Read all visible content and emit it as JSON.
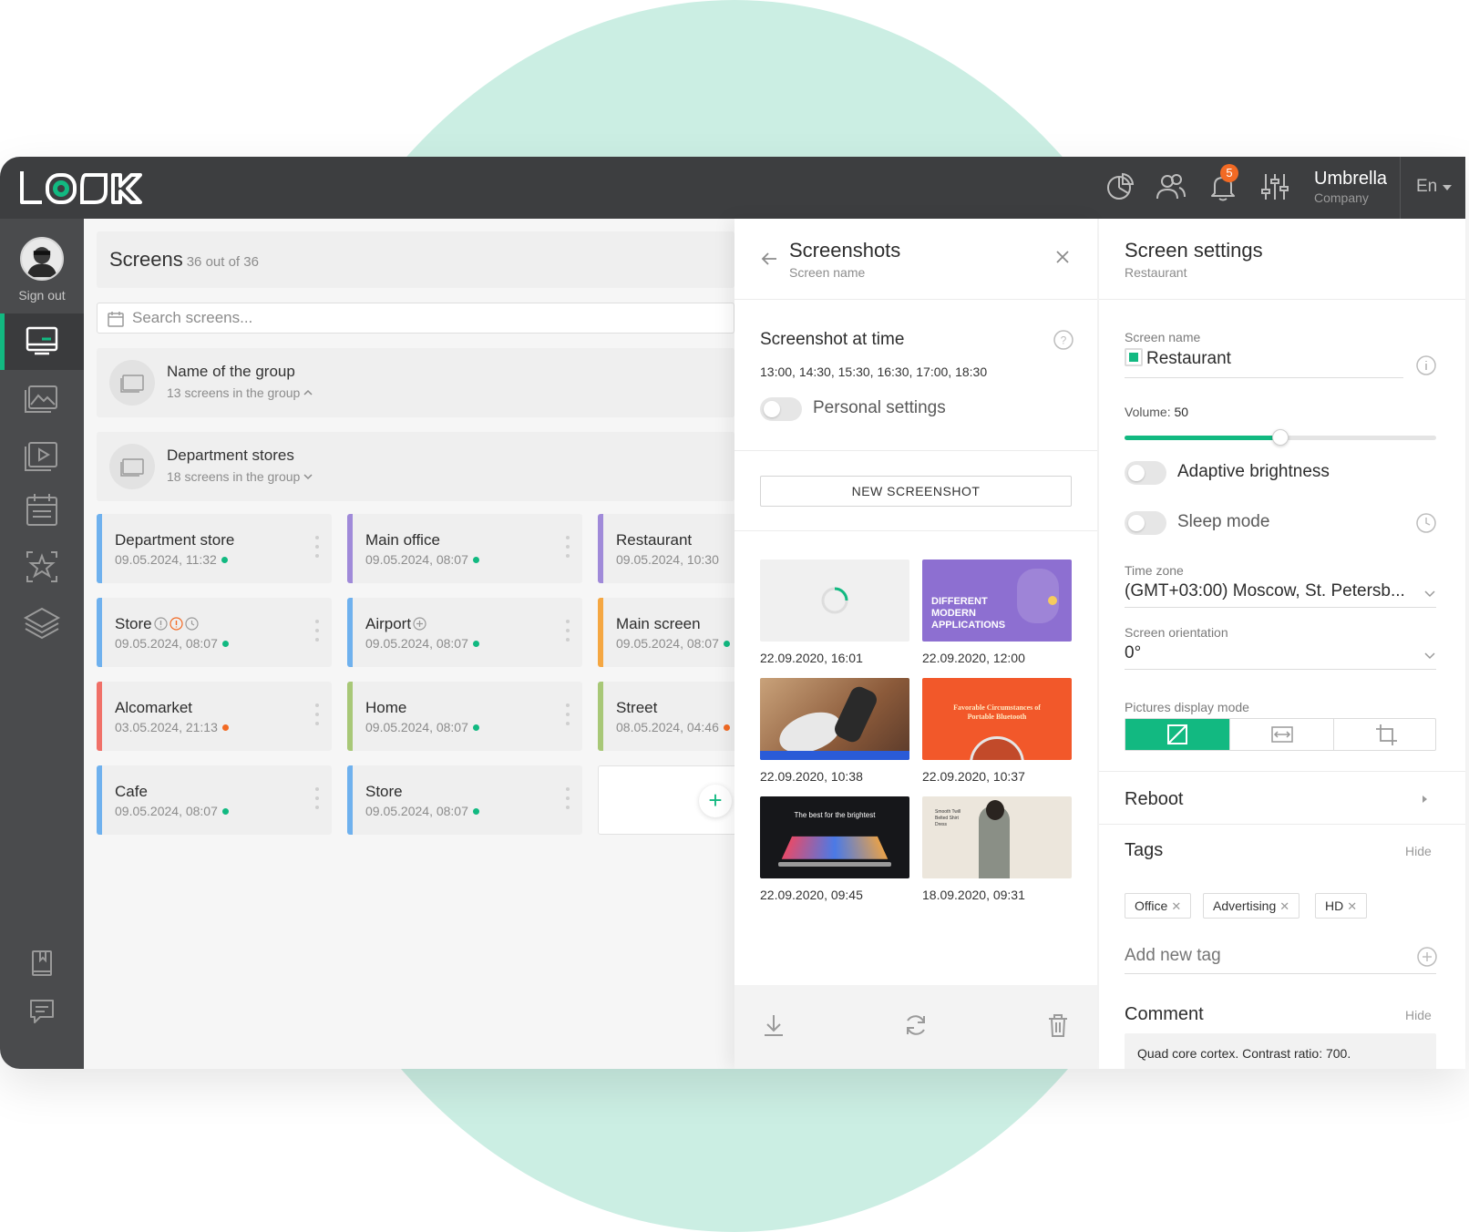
{
  "header": {
    "company_name": "Umbrella",
    "company_sub": "Company",
    "language": "En",
    "notification_count": "5",
    "icons": [
      "analytics-icon",
      "users-icon",
      "bell-icon",
      "sliders-icon"
    ]
  },
  "sidebar": {
    "sign_out": "Sign out",
    "items": [
      "screens-icon",
      "images-icon",
      "playlist-icon",
      "calendar-icon",
      "star-icon",
      "layers-icon",
      "book-icon",
      "chat-icon"
    ],
    "active_color": "#12b981"
  },
  "screens": {
    "title": "Screens",
    "count": "36 out of 36",
    "search_placeholder": "Search screens...",
    "groups": [
      {
        "name": "Name of the group",
        "sub": "13 screens in the group"
      },
      {
        "name": "Department stores",
        "sub": "18 screens in the group"
      }
    ],
    "cards": [
      {
        "name": "Department store",
        "date": "09.05.2024, 11:32",
        "stripe": "#6fb1ee",
        "status": "#12b981"
      },
      {
        "name": "Main office",
        "date": "09.05.2024, 08:07",
        "stripe": "#a08ad9",
        "status": "#12b981"
      },
      {
        "name": "Restaurant",
        "date": "09.05.2024, 10:30",
        "stripe": "#a08ad9",
        "status": ""
      },
      {
        "name": "Store",
        "date": "09.05.2024, 08:07",
        "stripe": "#6fb1ee",
        "status": "#12b981"
      },
      {
        "name": "Airport",
        "date": "09.05.2024, 08:07",
        "stripe": "#6fb1ee",
        "status": "#12b981"
      },
      {
        "name": "Main screen",
        "date": "09.05.2024, 08:07",
        "stripe": "#f5a742",
        "status": "#12b981"
      },
      {
        "name": "Alcomarket",
        "date": "03.05.2024, 21:13",
        "stripe": "#f07068",
        "status": "#f26a24"
      },
      {
        "name": "Home",
        "date": "09.05.2024, 08:07",
        "stripe": "#a8c877",
        "status": "#12b981"
      },
      {
        "name": "Street",
        "date": "08.05.2024, 04:46",
        "stripe": "#a8c877",
        "status": "#f26a24"
      },
      {
        "name": "Cafe",
        "date": "09.05.2024, 08:07",
        "stripe": "#6fb1ee",
        "status": "#12b981"
      },
      {
        "name": "Store",
        "date": "09.05.2024, 08:07",
        "stripe": "#6fb1ee",
        "status": "#12b981"
      }
    ],
    "add_label": "+"
  },
  "screenshots": {
    "title": "Screenshots",
    "subtitle": "Screen name",
    "at_time_title": "Screenshot at time",
    "times": "13:00, 14:30, 15:30, 16:30, 17:00, 18:30",
    "personal_settings": "Personal settings",
    "new_button": "NEW SCREENSHOT",
    "thumbs": [
      {
        "caption": "22.09.2020, 16:01",
        "kind": "loading"
      },
      {
        "caption": "22.09.2020, 12:00",
        "kind": "purple",
        "text": "DIFFERENT MODERN APPLICATIONS"
      },
      {
        "caption": "22.09.2020, 10:38",
        "kind": "sport"
      },
      {
        "caption": "22.09.2020, 10:37",
        "kind": "orange",
        "text": "Favorable Circumstances of Portable Bluetooth"
      },
      {
        "caption": "22.09.2020, 09:45",
        "kind": "dark",
        "text": "The best for the brightest"
      },
      {
        "caption": "18.09.2020, 09:31",
        "kind": "fashion",
        "text": "Smooth Twill Belted Shirt Dress"
      }
    ],
    "footer_icons": [
      "download-icon",
      "refresh-icon",
      "trash-icon"
    ]
  },
  "settings": {
    "title": "Screen settings",
    "subtitle": "Restaurant",
    "screen_name_label": "Screen name",
    "screen_name_value": "Restaurant",
    "volume_label": "Volume:",
    "volume_value": "50",
    "volume_fraction": 0.5,
    "adaptive_brightness": "Adaptive brightness",
    "sleep_mode": "Sleep mode",
    "time_zone_label": "Time zone",
    "time_zone_value": "(GMT+03:00) Moscow, St. Petersb...",
    "orientation_label": "Screen orientation",
    "orientation_value": "0°",
    "pictures_mode_label": "Pictures display mode",
    "pictures_modes": [
      "stretch-icon",
      "fit-width-icon",
      "crop-icon"
    ],
    "reboot": "Reboot",
    "tags_title": "Tags",
    "tags_hide": "Hide",
    "tags": [
      "Office",
      "Advertising",
      "HD"
    ],
    "add_tag_placeholder": "Add new tag",
    "comment_title": "Comment",
    "comment_hide": "Hide",
    "comment_text": "Quad core cortex. Contrast ratio: 700."
  }
}
